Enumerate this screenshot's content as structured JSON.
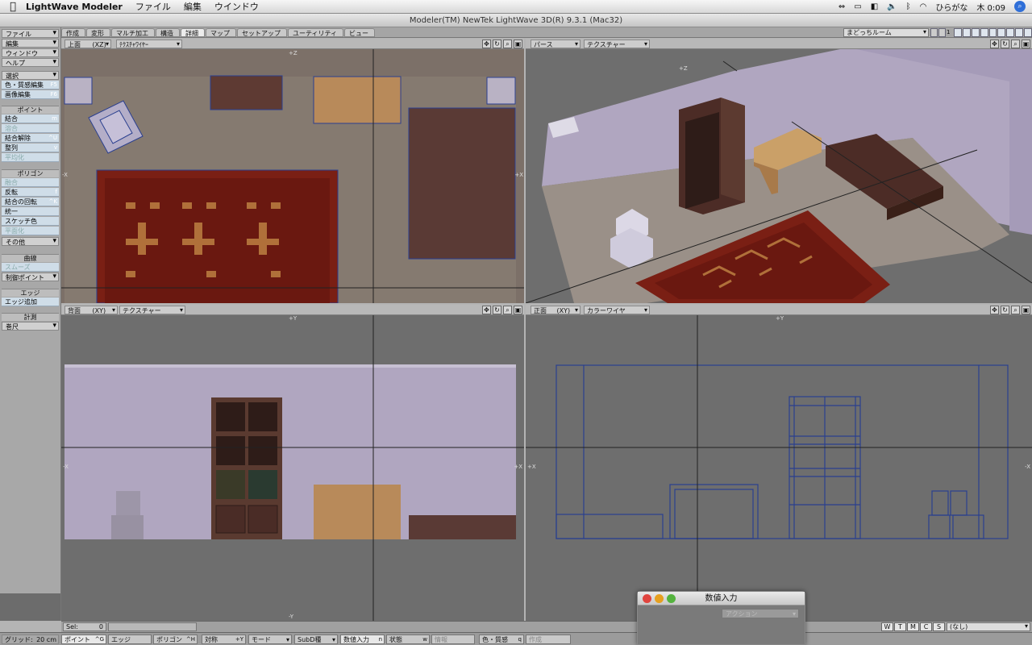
{
  "menubar": {
    "app": "LightWave Modeler",
    "items": [
      "ファイル",
      "編集",
      "ウインドウ"
    ],
    "ime": "ひらがな",
    "clock": "木 0:09"
  },
  "window": {
    "title": "Modeler(TM) NewTek LightWave 3D(R) 9.3.1 (Mac32)"
  },
  "tabs": [
    "作成",
    "変形",
    "マルチ加工",
    "構造",
    "詳細",
    "マップ",
    "セットアップ",
    "ユーティリティ",
    "ビュー"
  ],
  "active_tab": "詳細",
  "room_select": "まどっちルーム",
  "layer_page": "1",
  "left_panel": {
    "top_menus": [
      "ファイル",
      "編集",
      "ウィンドウ",
      "ヘルプ"
    ],
    "select_menu": "選択",
    "color_edit": {
      "label": "色・質感編集",
      "key": "F5"
    },
    "image_edit": {
      "label": "画像編集",
      "key": "F6"
    },
    "section_point": "ポイント",
    "point_tools": [
      {
        "label": "結合",
        "key": "m",
        "disabled": false
      },
      {
        "label": "溶合",
        "key": "",
        "disabled": true
      },
      {
        "label": "結合解除",
        "key": "^U",
        "disabled": false
      },
      {
        "label": "整列",
        "key": "v",
        "disabled": false
      },
      {
        "label": "平均化",
        "key": "",
        "disabled": true
      }
    ],
    "section_polygon": "ポリゴン",
    "polygon_tools": [
      {
        "label": "融合",
        "key": "",
        "disabled": true
      },
      {
        "label": "反転",
        "key": "f",
        "disabled": false
      },
      {
        "label": "結合の回転",
        "key": "^K",
        "disabled": false
      },
      {
        "label": "統一",
        "key": "",
        "disabled": false
      },
      {
        "label": "スケッチ色",
        "key": "",
        "disabled": false
      },
      {
        "label": "平面化",
        "key": "",
        "disabled": true
      }
    ],
    "polygon_more": "その他",
    "section_curve": "曲線",
    "curve_smooth": "スムーズ",
    "curve_ctrl": "制御ポイント",
    "section_edge": "エッジ",
    "edge_add": "エッジ追加",
    "section_measure": "計測",
    "measure_tool": "巻尺"
  },
  "viewports": {
    "top": {
      "view": "上面",
      "axes": "(XZ)",
      "mode": "ﾃｸｽﾁｬﾜｲﾔｰ",
      "axis_top": "+Z",
      "axis_left": "-X",
      "axis_right": "+X"
    },
    "persp": {
      "view": "パース",
      "mode": "テクスチャー",
      "axis_top": "+Z"
    },
    "back": {
      "view": "背面",
      "axes": "(XY)",
      "mode": "テクスチャー",
      "axis_top": "+Y",
      "axis_left": "-X",
      "axis_right": "+X",
      "axis_bottom": "-Y"
    },
    "front": {
      "view": "正面",
      "axes": "(XY)",
      "mode": "カラーワイヤ",
      "axis_top": "+Y",
      "axis_left": "+X",
      "axis_right": "-X"
    }
  },
  "status": {
    "sel_label": "Sel:",
    "sel_value": "0",
    "wtmcs": [
      "W",
      "T",
      "M",
      "C",
      "S"
    ],
    "surface": "(なし)"
  },
  "bottombar": {
    "grid_label": "グリッド:",
    "grid_value": "20 cm",
    "point": {
      "label": "ポイント",
      "key": "^G"
    },
    "edge": {
      "label": "エッジ",
      "key": ""
    },
    "polygon": {
      "label": "ポリゴン",
      "key": "^H"
    },
    "symmetry": {
      "label": "対称",
      "key": "+Y"
    },
    "mode": "モード",
    "subd": "SubD種",
    "numeric": {
      "label": "数値入力",
      "key": "n"
    },
    "state": {
      "label": "状態",
      "key": "w"
    },
    "info": "情報",
    "surface": {
      "label": "色・質感",
      "key": "q"
    },
    "work": "作成"
  },
  "numeric_window": {
    "title": "数値入力",
    "action": "アクション"
  },
  "colors": {
    "accent_blue": "#2a3f8f",
    "viewport_bg": "#6e6e6e",
    "wall": "#b0a6c0",
    "wood_dark": "#5a3a30",
    "wood_light": "#b88a5a",
    "rug": "#7a1f14"
  }
}
